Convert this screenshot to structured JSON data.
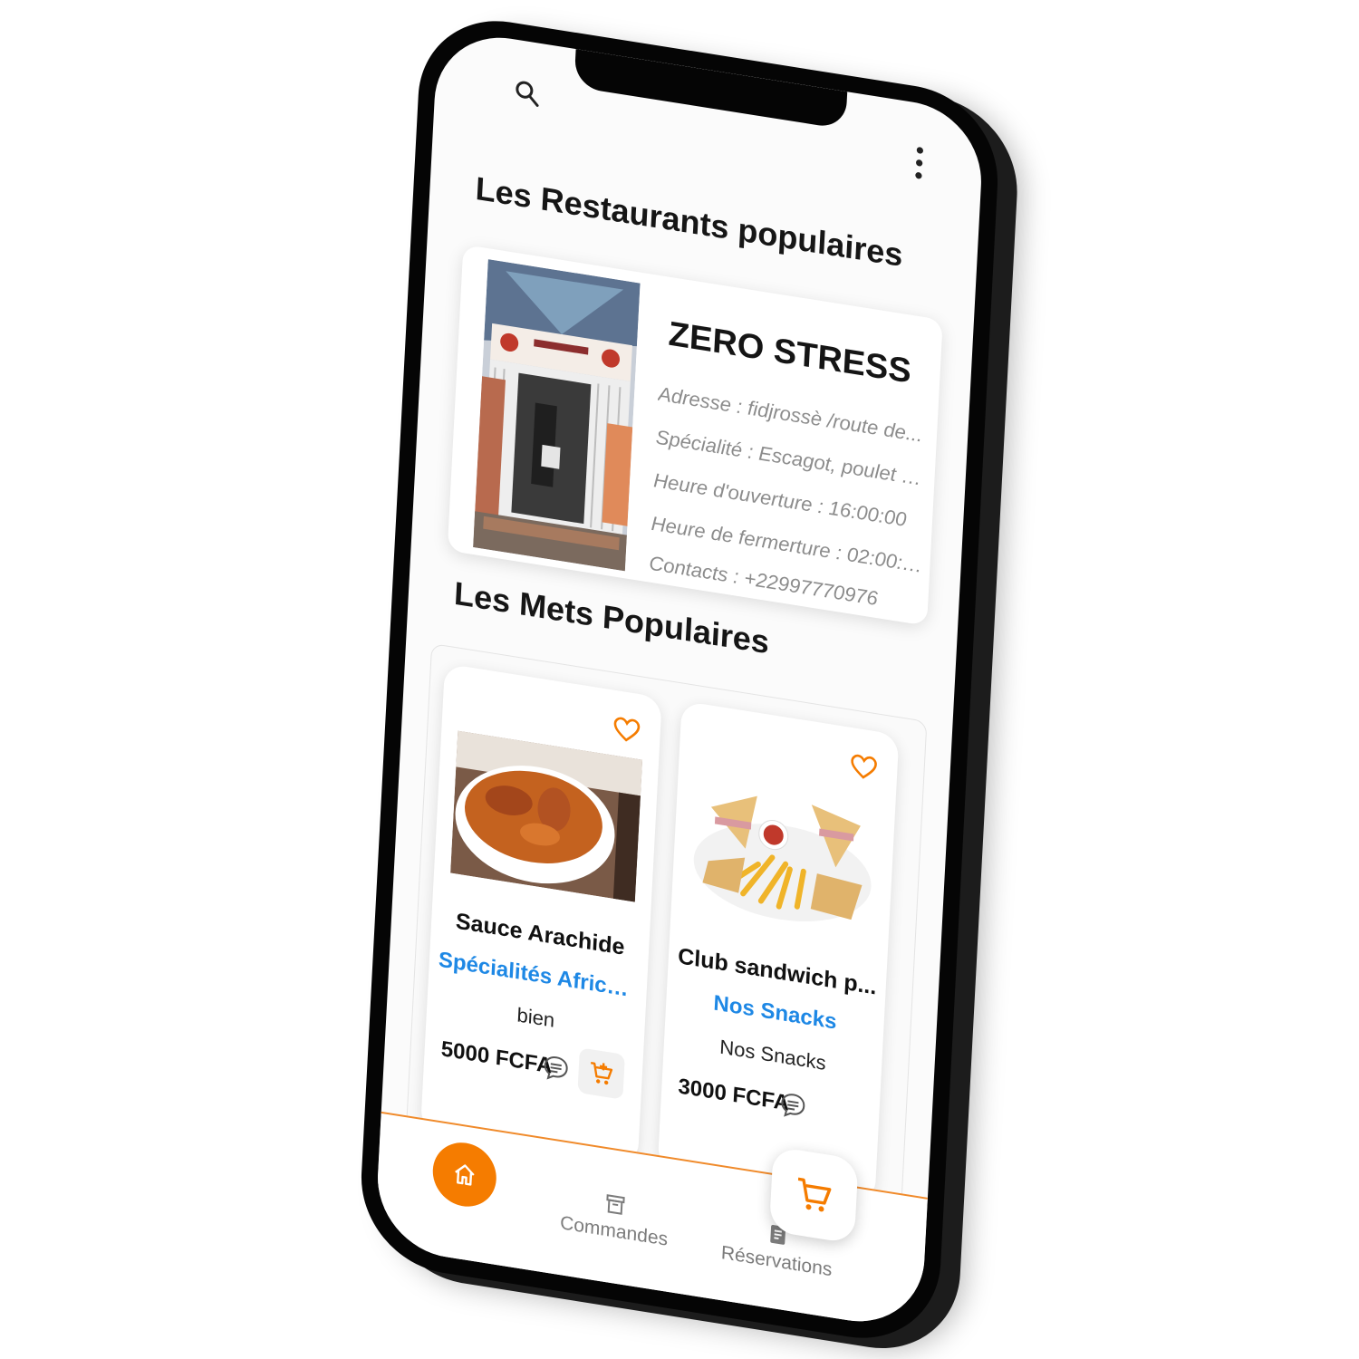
{
  "sections": {
    "restaurants_title": "Les Restaurants populaires",
    "dishes_title": "Les Mets Populaires"
  },
  "restaurant": {
    "name": "ZERO STRESS",
    "address": "Adresse : fidjrossè /route de...",
    "specialty": "Spécialité : Escagot, poulet b...",
    "opening": "Heure d'ouverture : 16:00:00",
    "closing": "Heure de fermerture : 02:00:00",
    "contacts": "Contacts : +22997770976"
  },
  "dishes": [
    {
      "name": "Sauce Arachide",
      "category": "Spécialités Africain...",
      "description": "bien",
      "price": "5000 FCFA"
    },
    {
      "name": "Club sandwich p...",
      "category": "Nos Snacks",
      "description": "Nos Snacks",
      "price": "3000 FCFA"
    }
  ],
  "nav": {
    "commandes": "Commandes",
    "reservations": "Réservations"
  },
  "colors": {
    "accent": "#f57c00",
    "link": "#1e88e5"
  },
  "icons": [
    "search-icon",
    "more-vert-icon",
    "heart-outline-icon",
    "chat-icon",
    "add-cart-icon",
    "home-icon",
    "archive-icon",
    "document-icon",
    "cart-icon"
  ]
}
